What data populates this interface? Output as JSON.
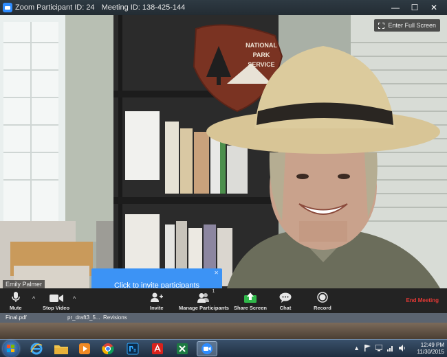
{
  "window": {
    "title": "Zoom Participant ID: 24",
    "meeting_id": "Meeting ID: 138-425-144",
    "minimize": "—",
    "maximize": "☐",
    "close": "✕"
  },
  "video": {
    "fullscreen_label": "Enter Full Screen",
    "participant_name": "Emily Palmer",
    "sign_lines": [
      "NATIONAL",
      "PARK",
      "SERVICE"
    ]
  },
  "invite_popup": {
    "text": "Click to invite participants",
    "close": "✕"
  },
  "toolbar": {
    "mute": "Mute",
    "stop_video": "Stop Video",
    "invite": "Invite",
    "manage_participants": "Manage Participants",
    "participant_count": "1",
    "share_screen": "Share Screen",
    "chat": "Chat",
    "record": "Record",
    "end_meeting": "End Meeting",
    "caret": "^"
  },
  "background_windows": [
    "Final.pdf",
    "pr_draft3_5...",
    "Revisions"
  ],
  "taskbar": {
    "time": "12:49 PM",
    "date": "11/30/2015",
    "tray_arrow": "▲"
  },
  "colors": {
    "accent": "#2d8cff",
    "end_meeting": "#e53935",
    "popup": "#3c93f5"
  }
}
